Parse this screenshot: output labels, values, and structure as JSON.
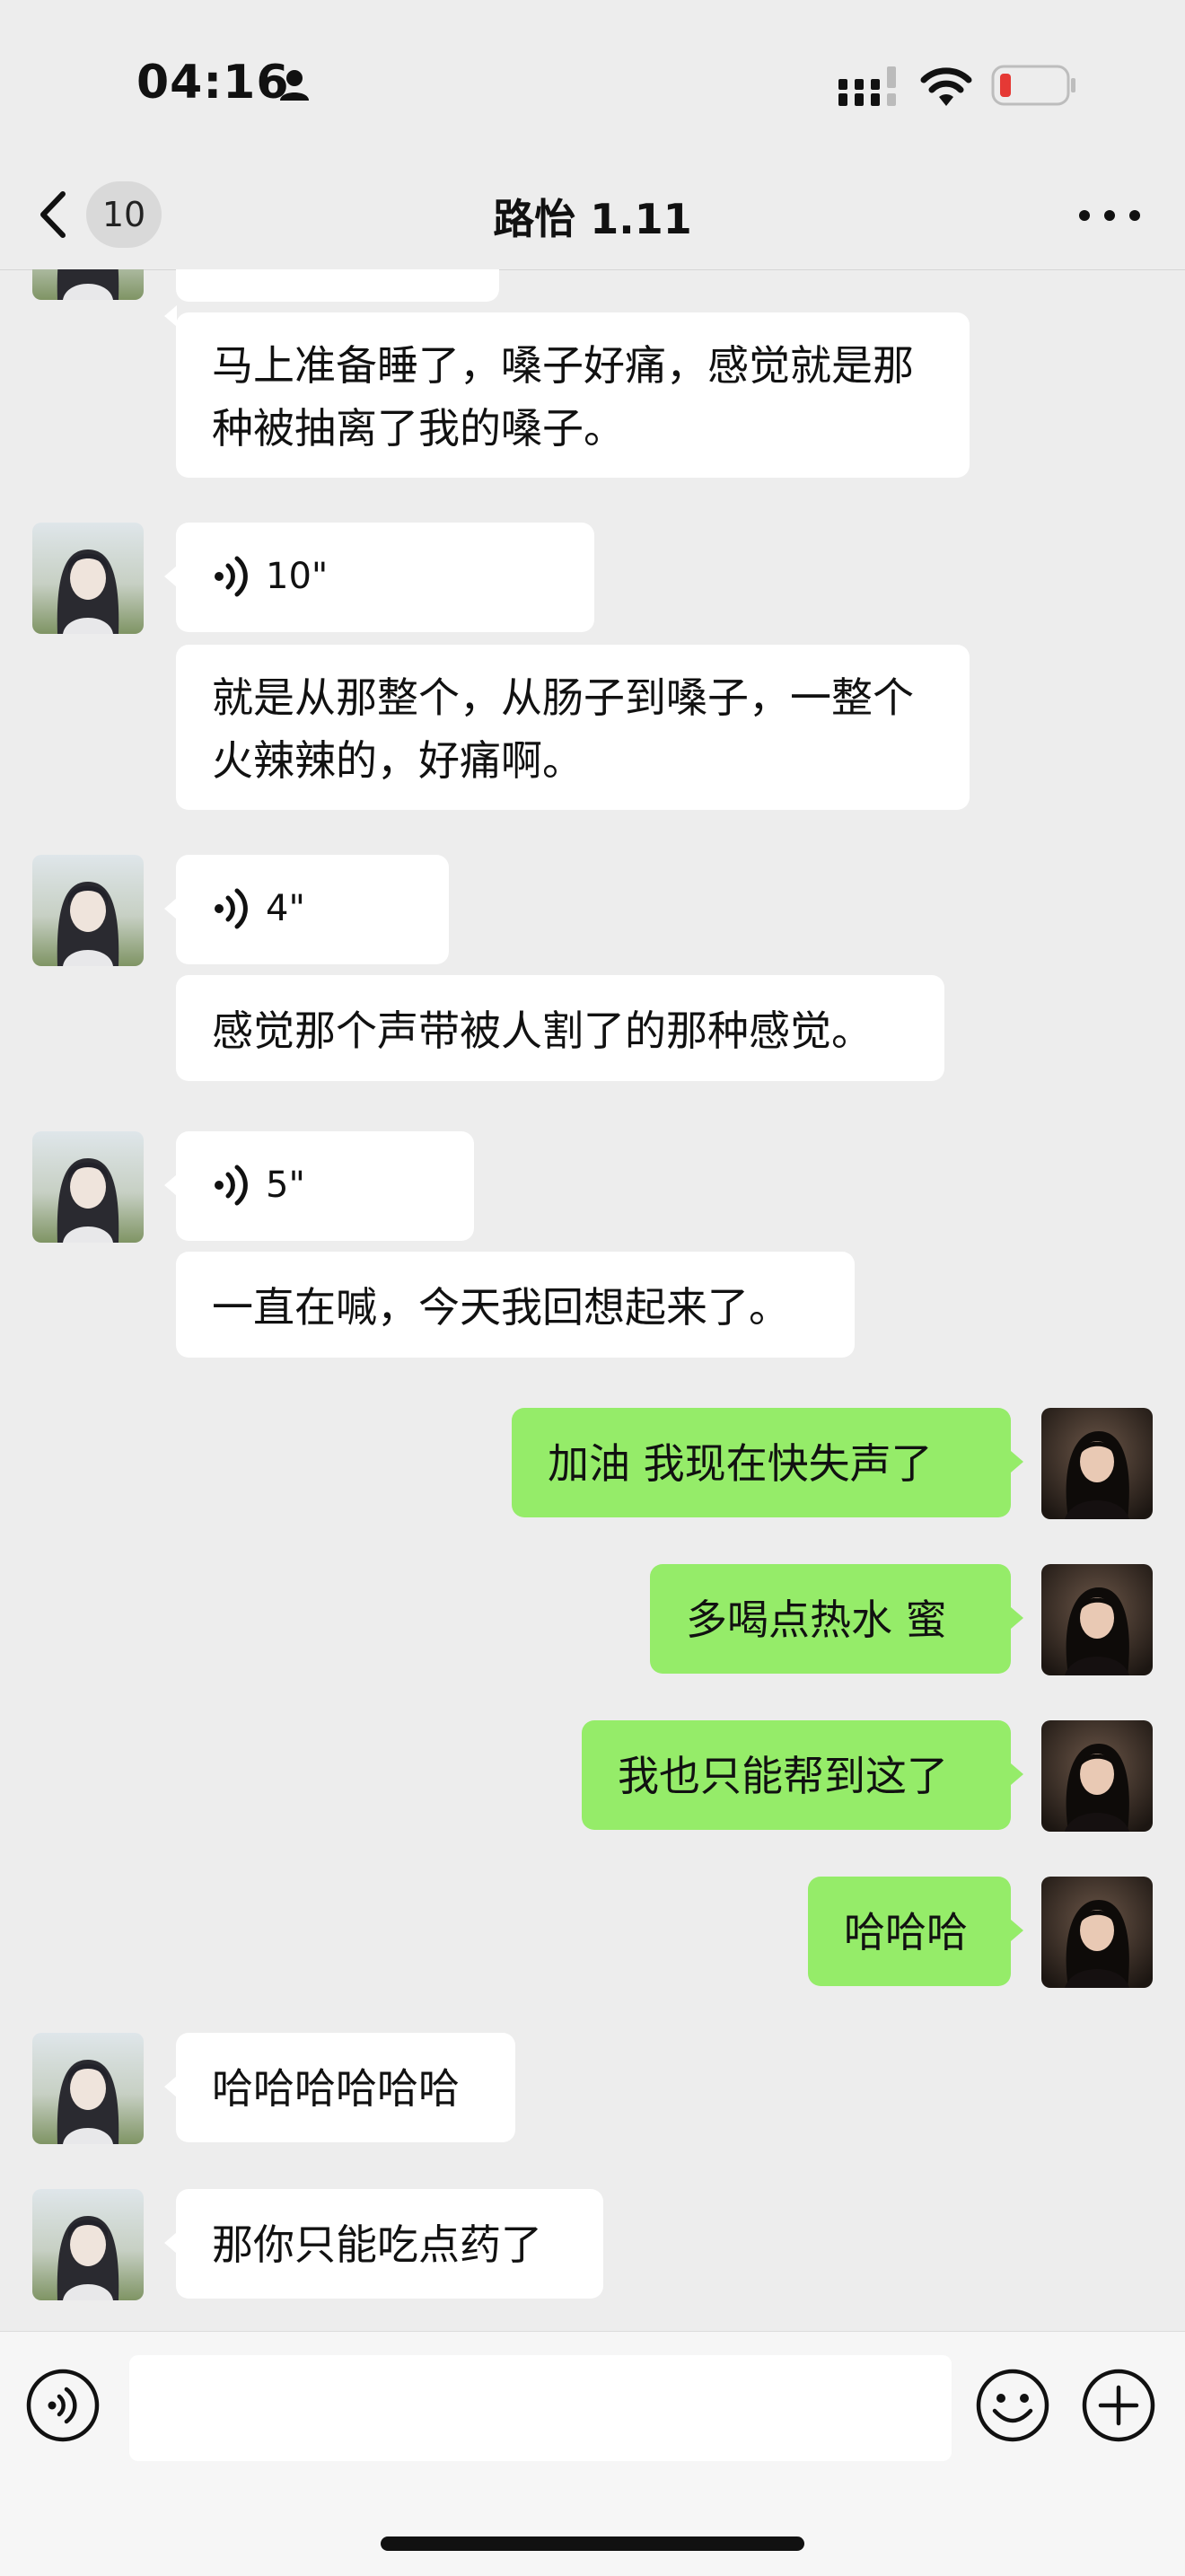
{
  "status_bar": {
    "time": "04:16",
    "icons": [
      "person-icon",
      "signal-icon",
      "wifi-icon",
      "battery-low-icon"
    ],
    "battery_color": "#e53935"
  },
  "nav": {
    "back_icon": "chevron-left-icon",
    "unread_count": "10",
    "title": "路怡 1.11",
    "more_icon": "more-dots-icon"
  },
  "colors": {
    "background": "#ededed",
    "received_bubble": "#ffffff",
    "sent_bubble": "#95ec69"
  },
  "messages": [
    {
      "sender": "other",
      "type": "text",
      "text": "马上准备睡了，嗓子好痛，感觉就是那种被抽离了我的嗓子。"
    },
    {
      "sender": "other",
      "type": "voice",
      "duration": "10\""
    },
    {
      "sender": "other",
      "type": "text",
      "text": "就是从那整个，从肠子到嗓子，一整个火辣辣的，好痛啊。"
    },
    {
      "sender": "other",
      "type": "voice",
      "duration": "4\""
    },
    {
      "sender": "other",
      "type": "text",
      "text": "感觉那个声带被人割了的那种感觉。"
    },
    {
      "sender": "other",
      "type": "voice",
      "duration": "5\""
    },
    {
      "sender": "other",
      "type": "text",
      "text": "一直在喊，今天我回想起来了。"
    },
    {
      "sender": "me",
      "type": "text",
      "text": "加油 我现在快失声了"
    },
    {
      "sender": "me",
      "type": "text",
      "text": "多喝点热水 蜜"
    },
    {
      "sender": "me",
      "type": "text",
      "text": "我也只能帮到这了"
    },
    {
      "sender": "me",
      "type": "text",
      "text": "哈哈哈"
    },
    {
      "sender": "other",
      "type": "text",
      "text": "哈哈哈哈哈哈"
    },
    {
      "sender": "other",
      "type": "text",
      "text": "那你只能吃点药了"
    }
  ],
  "input_bar": {
    "voice_icon": "voice-mode-icon",
    "input_value": "",
    "emoji_icon": "emoji-icon",
    "plus_icon": "plus-icon"
  }
}
